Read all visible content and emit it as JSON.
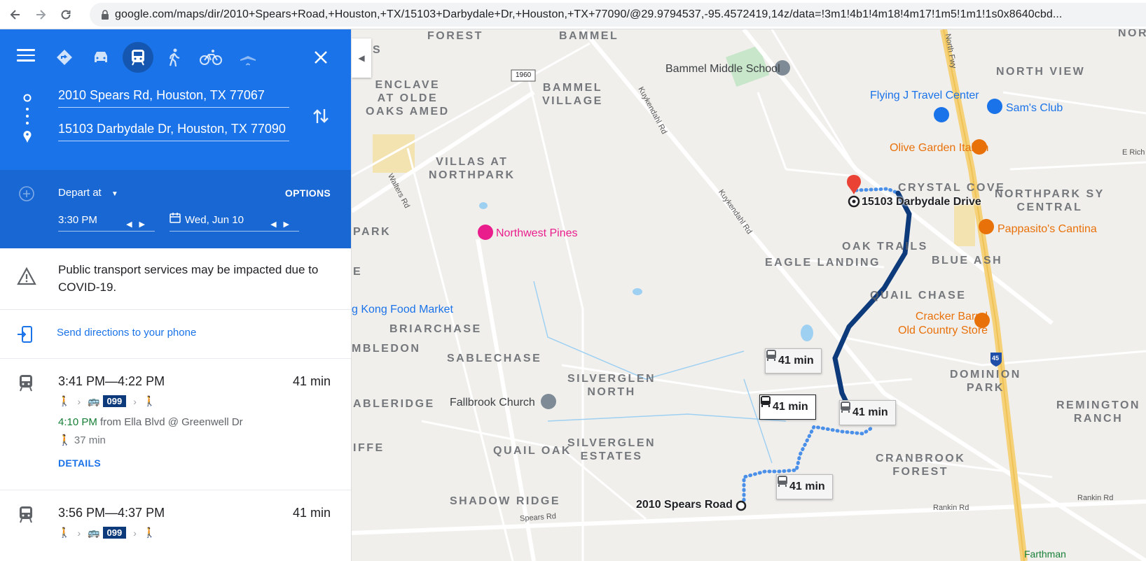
{
  "browser": {
    "url": "google.com/maps/dir/2010+Spears+Road,+Houston,+TX/15103+Darbydale+Dr,+Houston,+TX+77090/@29.9794537,-95.4572419,14z/data=!3m1!4b1!4m18!4m17!1m5!1m1!1s0x8640cbd..."
  },
  "directions": {
    "origin": "2010 Spears Rd, Houston, TX 77067",
    "destination": "15103 Darbydale Dr, Houston, TX 77090",
    "modes": [
      "best-route",
      "driving",
      "transit",
      "walking",
      "cycling",
      "flights"
    ],
    "active_mode": "transit",
    "depart_label": "Depart at",
    "options_label": "OPTIONS",
    "time": "3:30 PM",
    "date": "Wed, Jun 10"
  },
  "notice": {
    "text": "Public transport services may be impacted due to COVID-19."
  },
  "send": {
    "text": "Send directions to your phone"
  },
  "routes": [
    {
      "times": "3:41 PM—4:22 PM",
      "duration": "41 min",
      "bus": "099",
      "leave_time": "4:10 PM",
      "leave_from": " from Ella Blvd @ Greenwell Dr",
      "walk": "37 min",
      "details": "DETAILS"
    },
    {
      "times": "3:56 PM—4:37 PM",
      "duration": "41 min",
      "bus": "099"
    }
  ],
  "map": {
    "areas": [
      {
        "text": "FOREST"
      },
      {
        "text": "BAMMEL"
      },
      {
        "text": "ENCLAVE\nAT OLDE\nOAKS AMED"
      },
      {
        "text": "BAMMEL\nVILLAGE"
      },
      {
        "text": "VILLAS AT\nNORTHPARK"
      },
      {
        "text": "NORTH VIEW"
      },
      {
        "text": "CRYSTAL COVE"
      },
      {
        "text": "NORTHPARK SY\nCENTRAL"
      },
      {
        "text": "OAK TRAILS"
      },
      {
        "text": "EAGLE LANDING"
      },
      {
        "text": "BLUE ASH"
      },
      {
        "text": "QUAIL CHASE"
      },
      {
        "text": "PARK"
      },
      {
        "text": "BRIARCHASE"
      },
      {
        "text": "MBLEDON"
      },
      {
        "text": "SABLECHASE"
      },
      {
        "text": "SILVERGLEN\nNORTH"
      },
      {
        "text": "DOMINION\nPARK"
      },
      {
        "text": "REMINGTON\nRANCH"
      },
      {
        "text": "ABLERIDGE"
      },
      {
        "text": "IFFE"
      },
      {
        "text": "QUAIL OAK"
      },
      {
        "text": "SILVERGLEN\nESTATES"
      },
      {
        "text": "CRANBROOK\nFOREST"
      },
      {
        "text": "SHADOW RIDGE"
      },
      {
        "text": "NOR"
      },
      {
        "text": "S"
      },
      {
        "text": "E"
      }
    ],
    "pois": [
      {
        "text": "Bammel Middle School",
        "color": "#3c4043"
      },
      {
        "text": "Flying J Travel Center",
        "color": "#1a73e8"
      },
      {
        "text": "Sam's Club",
        "color": "#1a73e8"
      },
      {
        "text": "Olive Garden Italian",
        "color": "#e8710a"
      },
      {
        "text": "Pappasito's Cantina",
        "color": "#e8710a"
      },
      {
        "text": "Cracker Barrel\nOld Country Store",
        "color": "#e8710a"
      },
      {
        "text": "Northwest Pines",
        "color": "#e91e8c"
      },
      {
        "text": "Fallbrook Church",
        "color": "#3c4043"
      },
      {
        "text": "g Kong Food Market",
        "color": "#1a73e8"
      }
    ],
    "roads": [
      {
        "text": "Kuykendahl Rd"
      },
      {
        "text": "Kuykendahl Rd"
      },
      {
        "text": "Walters Rd"
      },
      {
        "text": "North Fwy"
      },
      {
        "text": "Rankin Rd"
      },
      {
        "text": "Rankin Rd"
      },
      {
        "text": "Spears Rd"
      },
      {
        "text": "E Rich"
      },
      {
        "text": "Farthman"
      },
      {
        "text": "1960"
      },
      {
        "text": "45"
      }
    ],
    "origin_label": "2010 Spears Road",
    "dest_label": "15103 Darbydale Drive",
    "chips": [
      "41 min",
      "41 min",
      "41 min",
      "41 min"
    ]
  }
}
